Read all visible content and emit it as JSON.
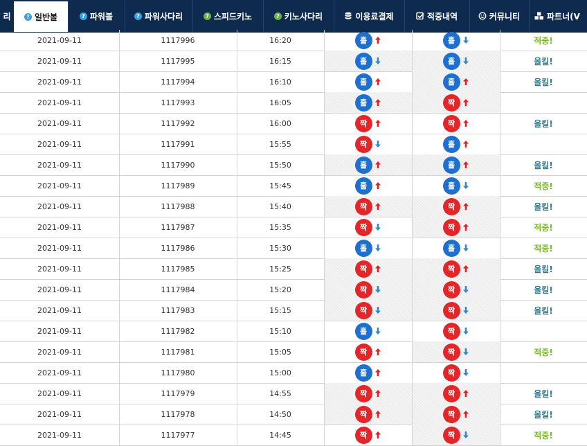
{
  "colors": {
    "nav_bg": "#0e2a4e",
    "hol": "#1f6fd0",
    "jjak": "#e3262a",
    "arrow_up": "#e02020",
    "arrow_down": "#2c88c8",
    "hit": "#7cb832",
    "allkill": "#2a7f93",
    "help_icon": "#3aa0e0",
    "green_icon": "#6ab04c"
  },
  "nav": {
    "items": [
      {
        "label": "리",
        "icon": null
      },
      {
        "label": "일반볼",
        "icon": "help-icon",
        "active": true
      },
      {
        "label": "파워볼",
        "icon": "help-icon"
      },
      {
        "label": "파워사다리",
        "icon": "help-icon"
      },
      {
        "label": "스피드키노",
        "icon": "help-green-icon"
      },
      {
        "label": "키노사다리",
        "icon": "help-green-icon"
      },
      {
        "label": "이용료결제",
        "icon": "database-icon"
      },
      {
        "label": "적중내역",
        "icon": "checkbox-icon"
      },
      {
        "label": "커뮤니티",
        "icon": "smile-icon"
      },
      {
        "label": "파트너(V",
        "icon": "cubes-icon"
      }
    ]
  },
  "balls": {
    "hol": "홀",
    "jjak": "짝"
  },
  "results": {
    "hit": "적중!",
    "allkill": "올킬!"
  },
  "rows": [
    {
      "date": "2021-09-11",
      "round": "1117996",
      "time": "16:20",
      "b1": "hol",
      "a1": "up",
      "b2": "hol",
      "a2": "down",
      "res": "hit"
    },
    {
      "date": "2021-09-11",
      "round": "1117995",
      "time": "16:15",
      "b1": "hol",
      "a1": "down",
      "b2": "hol",
      "a2": "down",
      "res": "allkill"
    },
    {
      "date": "2021-09-11",
      "round": "1117994",
      "time": "16:10",
      "b1": "hol",
      "a1": "up",
      "b2": "hol",
      "a2": "up",
      "res": "allkill"
    },
    {
      "date": "2021-09-11",
      "round": "1117993",
      "time": "16:05",
      "b1": "hol",
      "a1": "up",
      "b2": "jjak",
      "a2": "up",
      "res": ""
    },
    {
      "date": "2021-09-11",
      "round": "1117992",
      "time": "16:00",
      "b1": "jjak",
      "a1": "up",
      "b2": "jjak",
      "a2": "up",
      "res": "allkill"
    },
    {
      "date": "2021-09-11",
      "round": "1117991",
      "time": "15:55",
      "b1": "jjak",
      "a1": "down",
      "b2": "hol",
      "a2": "up",
      "res": ""
    },
    {
      "date": "2021-09-11",
      "round": "1117990",
      "time": "15:50",
      "b1": "hol",
      "a1": "up",
      "b2": "hol",
      "a2": "up",
      "res": "allkill"
    },
    {
      "date": "2021-09-11",
      "round": "1117989",
      "time": "15:45",
      "b1": "hol",
      "a1": "up",
      "b2": "hol",
      "a2": "down",
      "res": "hit"
    },
    {
      "date": "2021-09-11",
      "round": "1117988",
      "time": "15:40",
      "b1": "jjak",
      "a1": "up",
      "b2": "jjak",
      "a2": "up",
      "res": "allkill"
    },
    {
      "date": "2021-09-11",
      "round": "1117987",
      "time": "15:35",
      "b1": "jjak",
      "a1": "down",
      "b2": "jjak",
      "a2": "up",
      "res": "hit"
    },
    {
      "date": "2021-09-11",
      "round": "1117986",
      "time": "15:30",
      "b1": "hol",
      "a1": "down",
      "b2": "hol",
      "a2": "down",
      "res": "hit"
    },
    {
      "date": "2021-09-11",
      "round": "1117985",
      "time": "15:25",
      "b1": "jjak",
      "a1": "up",
      "b2": "jjak",
      "a2": "up",
      "res": "allkill"
    },
    {
      "date": "2021-09-11",
      "round": "1117984",
      "time": "15:20",
      "b1": "jjak",
      "a1": "down",
      "b2": "jjak",
      "a2": "down",
      "res": "allkill"
    },
    {
      "date": "2021-09-11",
      "round": "1117983",
      "time": "15:15",
      "b1": "jjak",
      "a1": "down",
      "b2": "jjak",
      "a2": "down",
      "res": "allkill"
    },
    {
      "date": "2021-09-11",
      "round": "1117982",
      "time": "15:10",
      "b1": "hol",
      "a1": "down",
      "b2": "jjak",
      "a2": "down",
      "res": ""
    },
    {
      "date": "2021-09-11",
      "round": "1117981",
      "time": "15:05",
      "b1": "jjak",
      "a1": "up",
      "b2": "jjak",
      "a2": "down",
      "res": "hit"
    },
    {
      "date": "2021-09-11",
      "round": "1117980",
      "time": "15:00",
      "b1": "hol",
      "a1": "up",
      "b2": "jjak",
      "a2": "down",
      "res": ""
    },
    {
      "date": "2021-09-11",
      "round": "1117979",
      "time": "14:55",
      "b1": "jjak",
      "a1": "up",
      "b2": "jjak",
      "a2": "up",
      "res": "allkill"
    },
    {
      "date": "2021-09-11",
      "round": "1117978",
      "time": "14:50",
      "b1": "jjak",
      "a1": "up",
      "b2": "jjak",
      "a2": "up",
      "res": "allkill"
    },
    {
      "date": "2021-09-11",
      "round": "1117977",
      "time": "14:45",
      "b1": "jjak",
      "a1": "up",
      "b2": "jjak",
      "a2": "down",
      "res": "hit"
    }
  ]
}
